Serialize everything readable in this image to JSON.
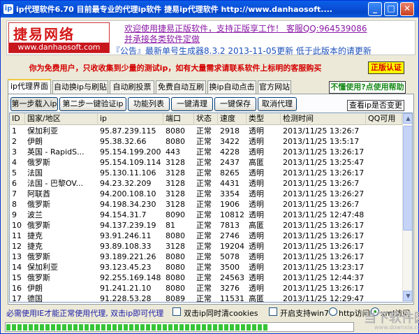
{
  "window": {
    "title": "ip代理软件6.70 目前最专业的代理ip软件 捷易ip代理软件 http://www.danhaosoft....",
    "icon": "app-icon",
    "controls": [
      "minimize",
      "maximize",
      "close"
    ]
  },
  "banner": {
    "logo_text": "捷易网络",
    "logo_url": "www.danhaosoft.com",
    "line1": "欢迎使用捷易正版软件，支持正版享工作！  客服QQ:964539086",
    "line2": "并承接各类软件定做",
    "line3": "『公告』最新单号生成器8.3.2 2013-11-05更新 低于此版本的请更新"
  },
  "notice": {
    "text": "你为免费用户，只收收集到少量的测试ip，如有大量需求请联系软件上标明的客服购买",
    "auth_button": "正版认证"
  },
  "tabs": [
    {
      "label": "ip代理界面",
      "active": true
    },
    {
      "label": "自动换ip与刷贴",
      "active": false
    },
    {
      "label": "自动刷投票",
      "active": false
    },
    {
      "label": "免费自动互刷",
      "active": false
    },
    {
      "label": "换ip自动点击",
      "active": false
    },
    {
      "label": "官方网站",
      "active": false
    }
  ],
  "help_button": "不懂使用?点使用帮助",
  "toolbar": {
    "load_ip": "第一步载入ip",
    "verify_ip": "第二步一键验证ip",
    "features": "功能列表",
    "clear": "一键清理",
    "save": "一键保存",
    "cancel_proxy": "取消代理",
    "view_ip_link": "查看ip是否变更"
  },
  "table": {
    "columns": [
      "ID",
      "国家/地区",
      "ip",
      "端口",
      "状态",
      "速度",
      "类型",
      "检测时间",
      "QQ可用"
    ],
    "rows": [
      [
        "1",
        "保加利亚",
        "95.87.239.115",
        "8080",
        "正常",
        "2918",
        "透明",
        "2013/11/25 13:26:7",
        ""
      ],
      [
        "2",
        "伊朗",
        "95.38.32.66",
        "8080",
        "正常",
        "3422",
        "透明",
        "2013/11/25 13:5:17",
        ""
      ],
      [
        "3",
        "英国 - RapidS...",
        "95.154.199.200",
        "443",
        "正常",
        "4228",
        "透明",
        "2013/11/25 13:26:17",
        ""
      ],
      [
        "4",
        "俄罗斯",
        "95.154.109.114",
        "3128",
        "正常",
        "2437",
        "高匿",
        "2013/11/25 13:25:47",
        ""
      ],
      [
        "5",
        "法国",
        "95.130.11.106",
        "3128",
        "正常",
        "8265",
        "透明",
        "2013/11/25 13:26:17",
        ""
      ],
      [
        "6",
        "法国 - 巴黎OV...",
        "94.23.32.209",
        "3128",
        "正常",
        "4431",
        "透明",
        "2013/11/25 13:26:7",
        ""
      ],
      [
        "7",
        "阿联酋",
        "94.200.108.10",
        "3128",
        "正常",
        "3354",
        "透明",
        "2013/11/25 13:26:27",
        ""
      ],
      [
        "8",
        "俄罗斯",
        "94.198.34.230",
        "3128",
        "正常",
        "1906",
        "透明",
        "2013/11/25 13:26:7",
        ""
      ],
      [
        "9",
        "波兰",
        "94.154.31.7",
        "8090",
        "正常",
        "10812",
        "透明",
        "2013/11/25 12:47:48",
        ""
      ],
      [
        "10",
        "俄罗斯",
        "94.137.239.19",
        "81",
        "正常",
        "7813",
        "高匿",
        "2013/11/25 13:26:17",
        ""
      ],
      [
        "11",
        "捷克",
        "93.91.246.11",
        "8080",
        "正常",
        "2746",
        "透明",
        "2013/11/25 13:26:17",
        ""
      ],
      [
        "12",
        "捷克",
        "93.89.108.33",
        "3128",
        "正常",
        "19204",
        "透明",
        "2013/11/25 13:26:17",
        ""
      ],
      [
        "13",
        "俄罗斯",
        "93.189.221.26",
        "8080",
        "正常",
        "5078",
        "透明",
        "2013/11/25 13:26:17",
        ""
      ],
      [
        "14",
        "保加利亚",
        "93.123.45.23",
        "8080",
        "正常",
        "3500",
        "透明",
        "2013/11/25 13:23:17",
        ""
      ],
      [
        "15",
        "俄罗斯",
        "92.255.169.148",
        "8080",
        "正常",
        "24563",
        "透明",
        "2013/11/25 12:44:37",
        ""
      ],
      [
        "16",
        "伊朗",
        "91.241.21.10",
        "8080",
        "正常",
        "3276",
        "透明",
        "2013/11/25 13:26:17",
        ""
      ],
      [
        "17",
        "德国",
        "91.228.53.28",
        "8089",
        "正常",
        "11531",
        "高匿",
        "2013/11/25 12:29:47",
        ""
      ]
    ]
  },
  "statusbar": {
    "hint": "必需使用IE才能正常使用代理, 双击ip即可代理",
    "cookie_label": "双击ip同时清cookies",
    "cookie_checked": false,
    "win7_label": "开启支持win7",
    "win7_checked": false,
    "http_label": "http访问",
    "http_selected": false,
    "xml_label": "xml访问",
    "xml_selected": true
  },
  "progress": {
    "fraction": 0.76
  },
  "watermark": {
    "text": "当下软件园",
    "sub": "www.downxia.com"
  }
}
